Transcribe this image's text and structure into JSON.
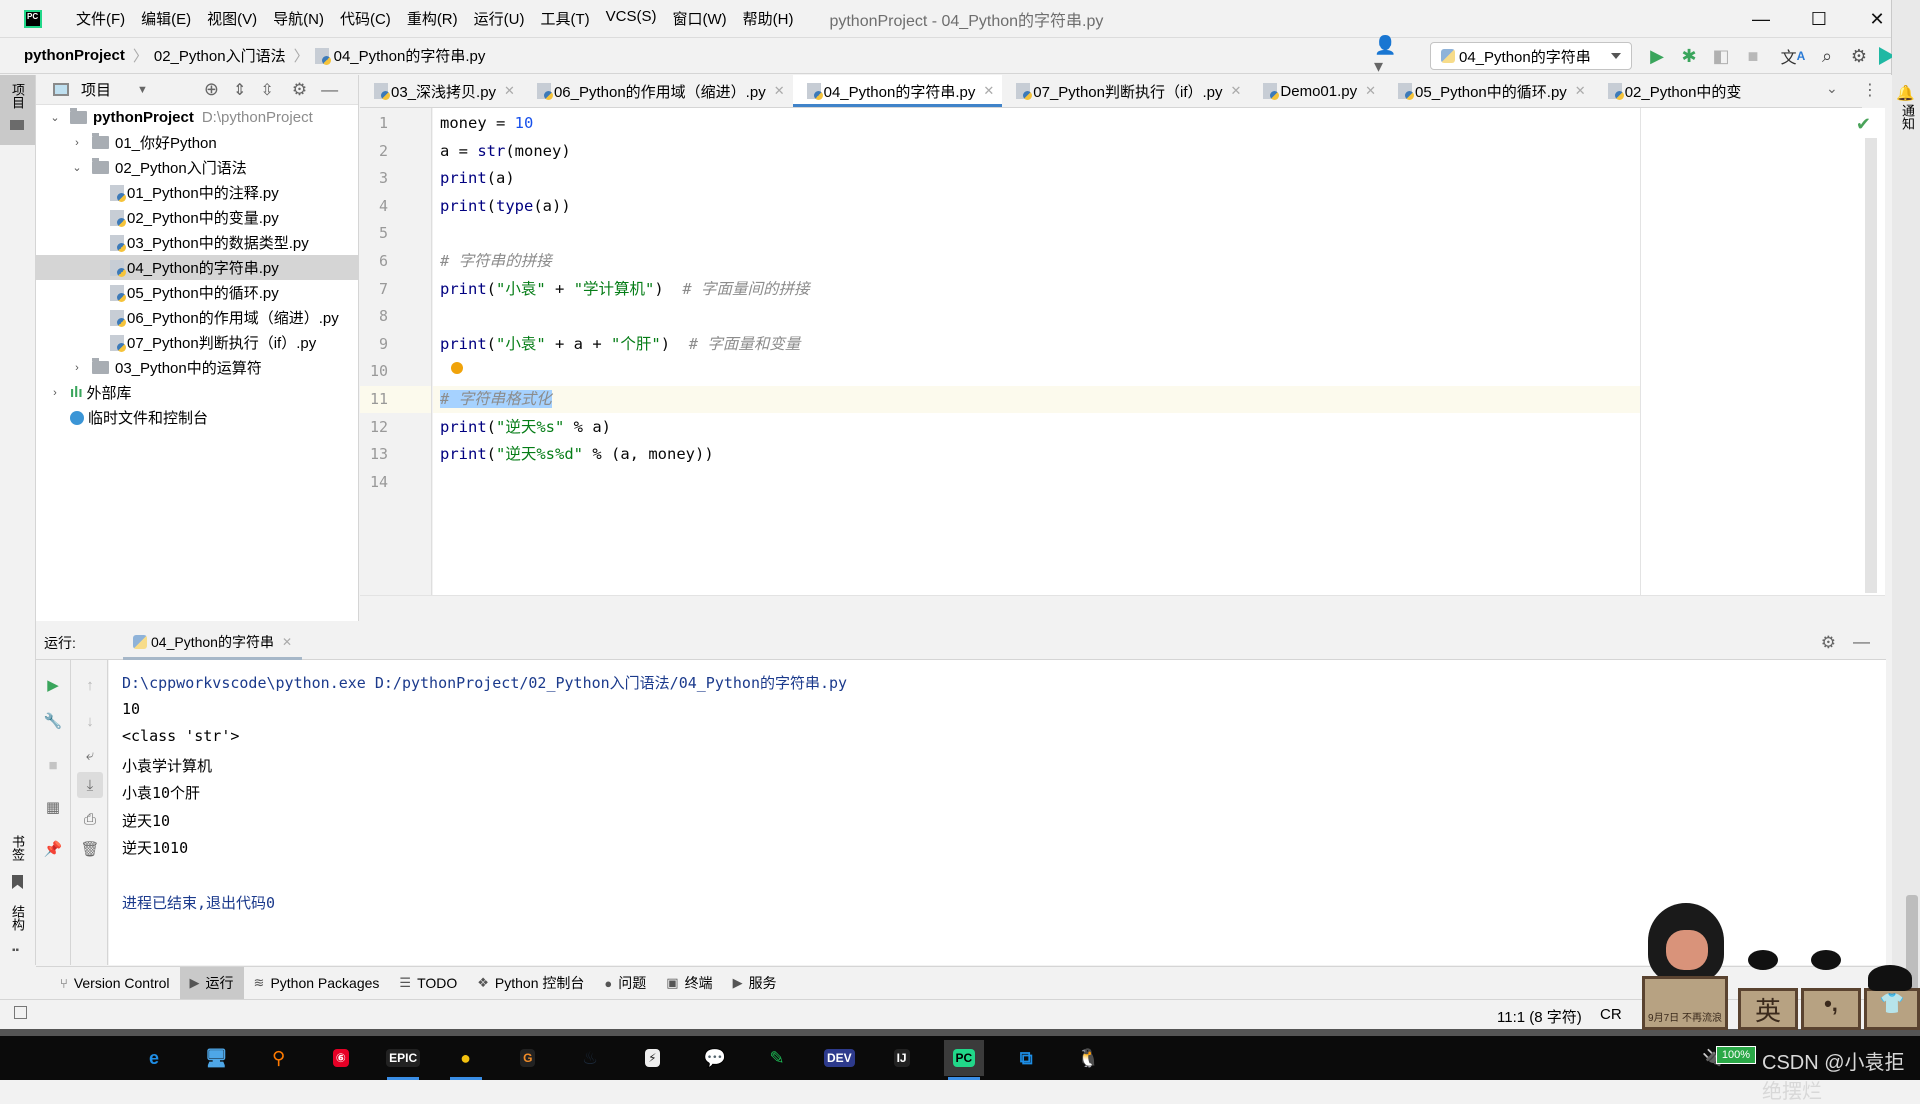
{
  "window": {
    "title": "pythonProject - 04_Python的字符串.py",
    "menu": [
      "文件(F)",
      "编辑(E)",
      "视图(V)",
      "导航(N)",
      "代码(C)",
      "重构(R)",
      "运行(U)",
      "工具(T)",
      "VCS(S)",
      "窗口(W)",
      "帮助(H)"
    ],
    "controls": {
      "minimize": "—",
      "maximize": "☐",
      "close": "✕"
    }
  },
  "navbar": {
    "breadcrumb": [
      "pythonProject",
      "02_Python入门语法",
      "04_Python的字符串.py"
    ],
    "run_config": "04_Python的字符串",
    "icons": [
      "user-icon",
      "run-icon",
      "debug-icon",
      "coverage-icon",
      "stop-icon",
      "translate-icon",
      "search-icon",
      "settings-icon",
      "plugin-icon"
    ]
  },
  "left_strip": {
    "top": "项目",
    "bottom": [
      "书签",
      "结构"
    ]
  },
  "right_strip": {
    "notifications": "通知"
  },
  "project_panel": {
    "title": "项目",
    "tree": [
      {
        "label": "pythonProject",
        "hint": "D:\\pythonProject",
        "type": "folder",
        "expanded": true,
        "level": 0
      },
      {
        "label": "01_你好Python",
        "type": "folder",
        "expanded": false,
        "level": 1
      },
      {
        "label": "02_Python入门语法",
        "type": "folder",
        "expanded": true,
        "level": 1
      },
      {
        "label": "01_Python中的注释.py",
        "type": "file",
        "level": 2
      },
      {
        "label": "02_Python中的变量.py",
        "type": "file",
        "level": 2
      },
      {
        "label": "03_Python中的数据类型.py",
        "type": "file",
        "level": 2
      },
      {
        "label": "04_Python的字符串.py",
        "type": "file",
        "level": 2,
        "selected": true
      },
      {
        "label": "05_Python中的循环.py",
        "type": "file",
        "level": 2
      },
      {
        "label": "06_Python的作用域（缩进）.py",
        "type": "file",
        "level": 2
      },
      {
        "label": "07_Python判断执行（if）.py",
        "type": "file",
        "level": 2
      },
      {
        "label": "03_Python中的运算符",
        "type": "folder",
        "expanded": false,
        "level": 1
      },
      {
        "label": "外部库",
        "type": "library",
        "expanded": false,
        "level": 0
      },
      {
        "label": "临时文件和控制台",
        "type": "scratch",
        "level": 0
      }
    ]
  },
  "editor": {
    "tabs": [
      {
        "label": "03_深浅拷贝.py",
        "active": false
      },
      {
        "label": "06_Python的作用域（缩进）.py",
        "active": false
      },
      {
        "label": "04_Python的字符串.py",
        "active": true
      },
      {
        "label": "07_Python判断执行（if）.py",
        "active": false
      },
      {
        "label": "Demo01.py",
        "active": false
      },
      {
        "label": "05_Python中的循环.py",
        "active": false
      },
      {
        "label": "02_Python中的变",
        "active": false
      }
    ],
    "current_line": 11,
    "lines": [
      [
        {
          "t": "money = ",
          "c": ""
        },
        {
          "t": "10",
          "c": "num"
        }
      ],
      [
        {
          "t": "a = ",
          "c": ""
        },
        {
          "t": "str",
          "c": "kw"
        },
        {
          "t": "(money)",
          "c": ""
        }
      ],
      [
        {
          "t": "print",
          "c": "kw"
        },
        {
          "t": "(a)",
          "c": ""
        }
      ],
      [
        {
          "t": "print",
          "c": "kw"
        },
        {
          "t": "(",
          "c": ""
        },
        {
          "t": "type",
          "c": "kw"
        },
        {
          "t": "(a))",
          "c": ""
        }
      ],
      [],
      [
        {
          "t": "# 字符串的拼接",
          "c": "cm"
        }
      ],
      [
        {
          "t": "print",
          "c": "kw"
        },
        {
          "t": "(",
          "c": ""
        },
        {
          "t": "\"小袁\"",
          "c": "str"
        },
        {
          "t": " + ",
          "c": ""
        },
        {
          "t": "\"学计算机\"",
          "c": "str"
        },
        {
          "t": ")  ",
          "c": ""
        },
        {
          "t": "# 字面量间的拼接",
          "c": "cm"
        }
      ],
      [],
      [
        {
          "t": "print",
          "c": "kw"
        },
        {
          "t": "(",
          "c": ""
        },
        {
          "t": "\"小袁\"",
          "c": "str"
        },
        {
          "t": " + a + ",
          "c": ""
        },
        {
          "t": "\"个肝\"",
          "c": "str"
        },
        {
          "t": ")  ",
          "c": ""
        },
        {
          "t": "# 字面量和变量",
          "c": "cm"
        }
      ],
      [],
      [
        {
          "t": "# 字符串格式化",
          "c": "cm sel"
        }
      ],
      [
        {
          "t": "print",
          "c": "kw"
        },
        {
          "t": "(",
          "c": ""
        },
        {
          "t": "\"逆天%s\"",
          "c": "str"
        },
        {
          "t": " % a)",
          "c": ""
        }
      ],
      [
        {
          "t": "print",
          "c": "kw"
        },
        {
          "t": "(",
          "c": ""
        },
        {
          "t": "\"逆天%s%d\"",
          "c": "str"
        },
        {
          "t": " % (a, money))",
          "c": ""
        }
      ],
      []
    ],
    "inspection_status": "ok"
  },
  "run_panel": {
    "label": "运行:",
    "tab": "04_Python的字符串",
    "output": [
      {
        "text": "D:\\cppworkvscode\\python.exe D:/pythonProject/02_Python入门语法/04_Python的字符串.py",
        "kind": "sys"
      },
      {
        "text": "10",
        "kind": "out"
      },
      {
        "text": "<class 'str'>",
        "kind": "out"
      },
      {
        "text": "小袁学计算机",
        "kind": "out"
      },
      {
        "text": "小袁10个肝",
        "kind": "out"
      },
      {
        "text": "逆天10",
        "kind": "out"
      },
      {
        "text": "逆天1010",
        "kind": "out"
      },
      {
        "text": "",
        "kind": "out"
      },
      {
        "text": "进程已结束,退出代码0",
        "kind": "sys"
      }
    ]
  },
  "tool_windows": [
    {
      "label": "Version Control",
      "icon": "⑂",
      "active": false
    },
    {
      "label": "运行",
      "icon": "▶",
      "active": true
    },
    {
      "label": "Python Packages",
      "icon": "≋",
      "active": false
    },
    {
      "label": "TODO",
      "icon": "☰",
      "active": false
    },
    {
      "label": "Python 控制台",
      "icon": "❖",
      "active": false
    },
    {
      "label": "问题",
      "icon": "●",
      "active": false
    },
    {
      "label": "终端",
      "icon": "▣",
      "active": false
    },
    {
      "label": "服务",
      "icon": "▶",
      "active": false
    }
  ],
  "status_bar": {
    "position": "11:1 (8 字符)",
    "line_sep": "CR"
  },
  "taskbar": {
    "apps": [
      "Edge",
      "此电脑",
      "Everything",
      "网易云音乐",
      "Epic Games",
      "Chrome",
      "GoLand",
      "Steam",
      "迅雷",
      "微信",
      "Typora",
      "Dev-C++",
      "IntelliJ IDEA",
      "PyCharm",
      "VS Code",
      "QQ"
    ],
    "active": "PyCharm",
    "battery": "100%",
    "watermark": "CSDN @小袁拒绝摆烂",
    "ime_boxes": [
      "英",
      "•,",
      "👕"
    ],
    "mascot_sign": [
      "9月7日",
      "不再流浪"
    ]
  }
}
